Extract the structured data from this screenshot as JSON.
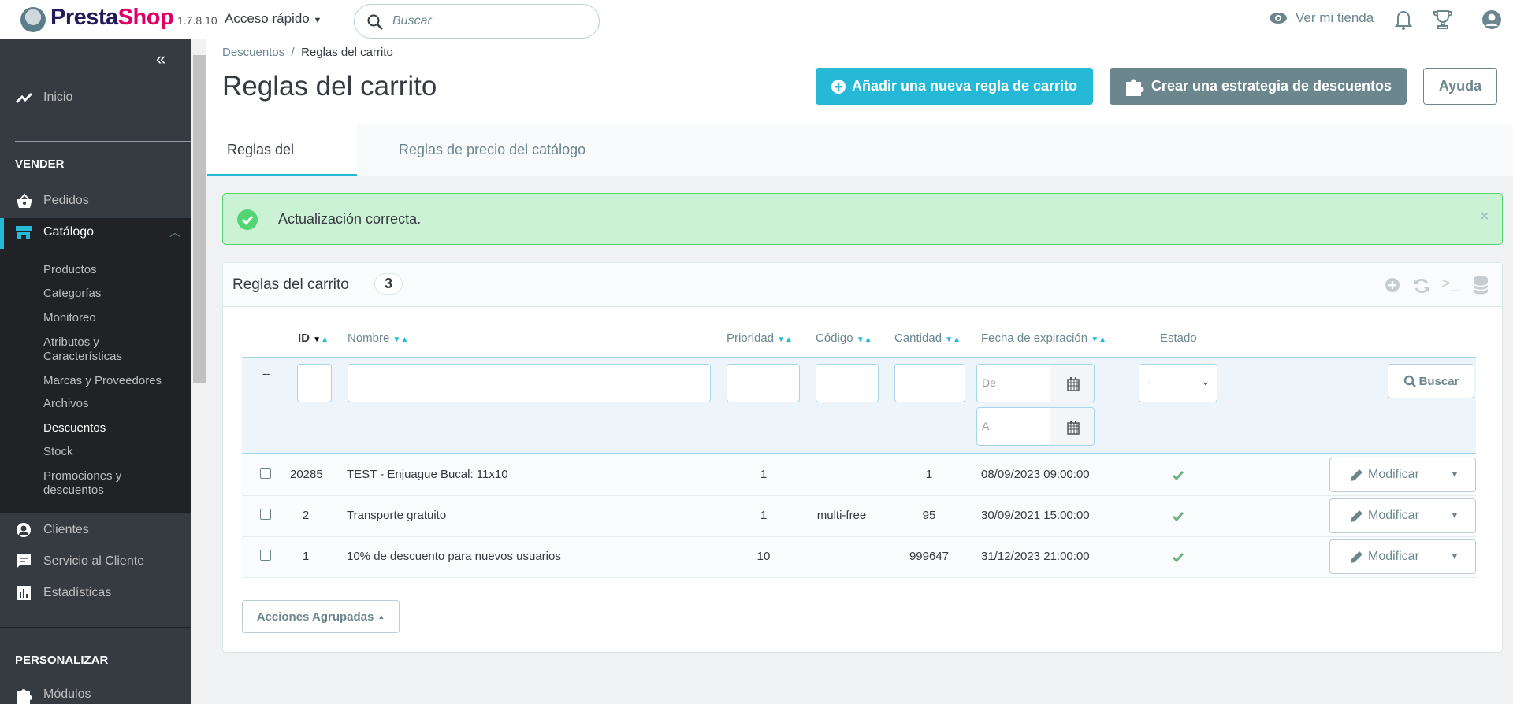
{
  "topbar": {
    "brand_a": "Presta",
    "brand_b": "Shop",
    "version": "1.7.8.10",
    "quick_access": "Acceso rápido",
    "search_placeholder": "Buscar",
    "view_store": "Ver mi tienda"
  },
  "sidebar": {
    "inicio": "Inicio",
    "sections": [
      "VENDER",
      "PERSONALIZAR"
    ],
    "pedidos": "Pedidos",
    "catalogo": "Catálogo",
    "sub": [
      "Productos",
      "Categorías",
      "Monitoreo",
      "Atributos y",
      "Características",
      "Marcas y Proveedores",
      "Archivos",
      "Descuentos",
      "Stock",
      "Promociones y",
      "descuentos"
    ],
    "clientes": "Clientes",
    "servicio": "Servicio al Cliente",
    "estadisticas": "Estadísticas",
    "modulos": "Módulos"
  },
  "header": {
    "breadcrumb_parent": "Descuentos",
    "breadcrumb_current": "Reglas del carrito",
    "title": "Reglas del carrito",
    "add_button": "Añadir una nueva regla de carrito",
    "strategy_button": "Crear una estrategia de descuentos",
    "help_button": "Ayuda"
  },
  "tabs": [
    "Reglas del carrito",
    "Reglas de precio del catálogo"
  ],
  "alert": {
    "text": "Actualización correcta.",
    "close": "×"
  },
  "panel": {
    "title": "Reglas del carrito",
    "count": "3",
    "columns": {
      "id": "ID",
      "name": "Nombre",
      "priority": "Prioridad",
      "code": "Código",
      "quantity": "Cantidad",
      "expiry": "Fecha de expiración",
      "status": "Estado"
    },
    "filter": {
      "dash": "--",
      "date_from": "De",
      "date_to": "A",
      "status_value": "-",
      "search": "Buscar"
    },
    "rows": [
      {
        "id": "20285",
        "name": "TEST - Enjuague Bucal: 11x10",
        "priority": "1",
        "code": "",
        "quantity": "1",
        "expiry": "08/09/2023 09:00:00",
        "action": "Modificar"
      },
      {
        "id": "2",
        "name": "Transporte gratuito",
        "priority": "1",
        "code": "multi-free",
        "quantity": "95",
        "expiry": "30/09/2021 15:00:00",
        "action": "Modificar"
      },
      {
        "id": "1",
        "name": "10% de descuento para nuevos usuarios",
        "priority": "10",
        "code": "",
        "quantity": "999647",
        "expiry": "31/12/2023 21:00:00",
        "action": "Modificar"
      }
    ],
    "bulk_actions": "Acciones Agrupadas"
  },
  "colors": {
    "accent": "#25b9d7",
    "sidebar": "#363a41",
    "success": "#70b580"
  }
}
